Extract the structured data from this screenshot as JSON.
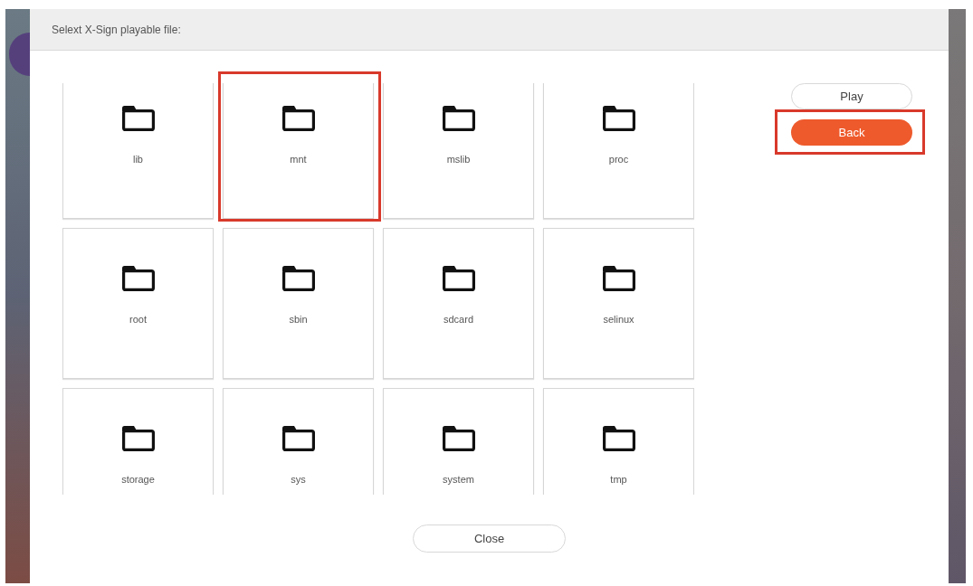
{
  "dialog": {
    "title": "Selext X-Sign playable file:"
  },
  "folders": [
    {
      "name": "lib",
      "highlighted": false
    },
    {
      "name": "mnt",
      "highlighted": true
    },
    {
      "name": "mslib",
      "highlighted": false
    },
    {
      "name": "proc",
      "highlighted": false
    },
    {
      "name": "root",
      "highlighted": false
    },
    {
      "name": "sbin",
      "highlighted": false
    },
    {
      "name": "sdcard",
      "highlighted": false
    },
    {
      "name": "selinux",
      "highlighted": false
    },
    {
      "name": "storage",
      "highlighted": false
    },
    {
      "name": "sys",
      "highlighted": false
    },
    {
      "name": "system",
      "highlighted": false
    },
    {
      "name": "tmp",
      "highlighted": false
    }
  ],
  "side_buttons": [
    {
      "label": "Play",
      "kind": "outline",
      "highlighted": false
    },
    {
      "label": "Back",
      "kind": "primary",
      "highlighted": true
    }
  ],
  "close_button": {
    "label": "Close"
  }
}
